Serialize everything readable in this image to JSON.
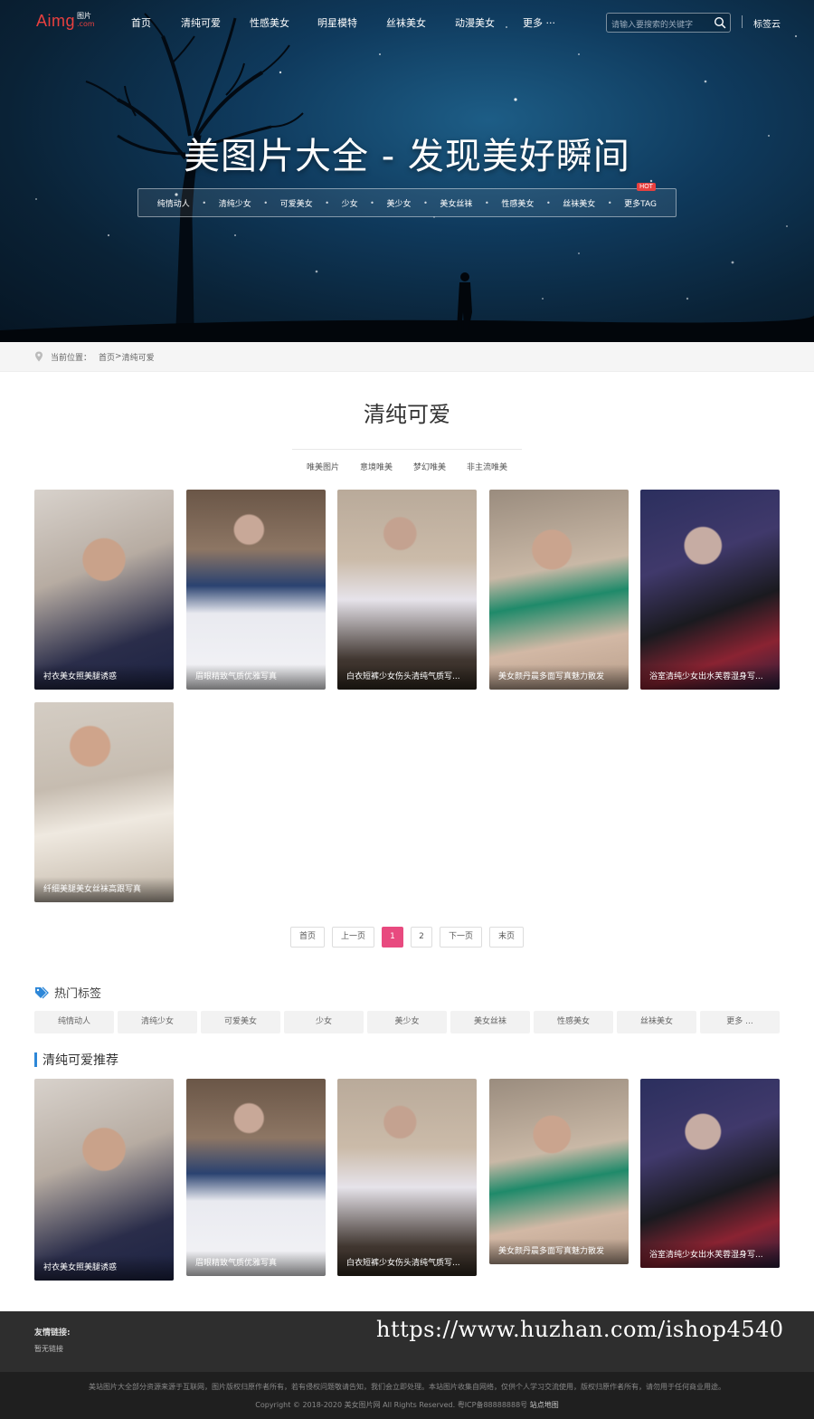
{
  "logo": {
    "main": "Aimg",
    "sub_top": "图片",
    "sub_bottom": ".com"
  },
  "nav": {
    "items": [
      "首页",
      "清纯可爱",
      "性感美女",
      "明星模特",
      "丝袜美女",
      "动漫美女",
      "更多 ···"
    ],
    "search_placeholder": "请输入要搜索的关键字",
    "tag_cloud": "标签云"
  },
  "hero": {
    "title": "美图片大全 - 发现美好瞬间",
    "tags": [
      "纯情动人",
      "清纯少女",
      "可爱美女",
      "少女",
      "美少女",
      "美女丝袜",
      "性感美女",
      "丝袜美女",
      "更多TAG"
    ],
    "hot_badge": "HOT"
  },
  "breadcrumb": {
    "label": "当前位置：",
    "home": "首页",
    "sep": ">",
    "current": "清纯可爱"
  },
  "category": {
    "title": "清纯可爱",
    "subcategories": [
      "唯美图片",
      "意境唯美",
      "梦幻唯美",
      "非主流唯美"
    ]
  },
  "gallery": [
    {
      "caption": "衬衣美女照美腿诱惑"
    },
    {
      "caption": "眉眼精致气质优雅写真"
    },
    {
      "caption": "白衣短裤少女伤头清纯气质写..."
    },
    {
      "caption": "美女颜丹晨多面写真魅力散发"
    },
    {
      "caption": "浴室清纯少女出水芙蓉湿身写..."
    },
    {
      "caption": "纤细美腿美女丝袜高跟写真"
    }
  ],
  "pagination": {
    "first": "首页",
    "prev": "上一页",
    "pages": [
      "1",
      "2"
    ],
    "current": "1",
    "next": "下一页",
    "last": "末页"
  },
  "hot_tags": {
    "title": "热门标签",
    "items": [
      "纯情动人",
      "清纯少女",
      "可爱美女",
      "少女",
      "美少女",
      "美女丝袜",
      "性感美女",
      "丝袜美女",
      "更多 ..."
    ]
  },
  "recommend": {
    "title": "清纯可爱推荐",
    "items": [
      {
        "caption": "衬衣美女照美腿诱惑"
      },
      {
        "caption": "眉眼精致气质优雅写真"
      },
      {
        "caption": "白衣短裤少女伤头清纯气质写..."
      },
      {
        "caption": "美女颜丹晨多面写真魅力散发"
      },
      {
        "caption": "浴室清纯少女出水芙蓉湿身写..."
      }
    ]
  },
  "footer": {
    "links_label": "友情链接:",
    "links_none": "暂无链接",
    "watermark": "https://www.huzhan.com/ishop4540",
    "disclaimer": "美站图片大全部分资源来源于互联网，图片版权归原作者所有，若有侵权问题敬请告知，我们会立即处理。本站图片收集自网络，仅供个人学习交流使用，版权归原作者所有，请勿用于任何商业用途。",
    "copyright": "Copyright © 2018-2020 美女图片网 All Rights Reserved. 粤ICP备88888888号",
    "sitemap": "站点地图"
  },
  "colors": {
    "accent_red": "#e8403f",
    "active_page": "#e84a7f",
    "section_bar": "#2d87d8",
    "footer_top": "#2e2e2e",
    "footer_bottom": "#1f1f1f"
  }
}
